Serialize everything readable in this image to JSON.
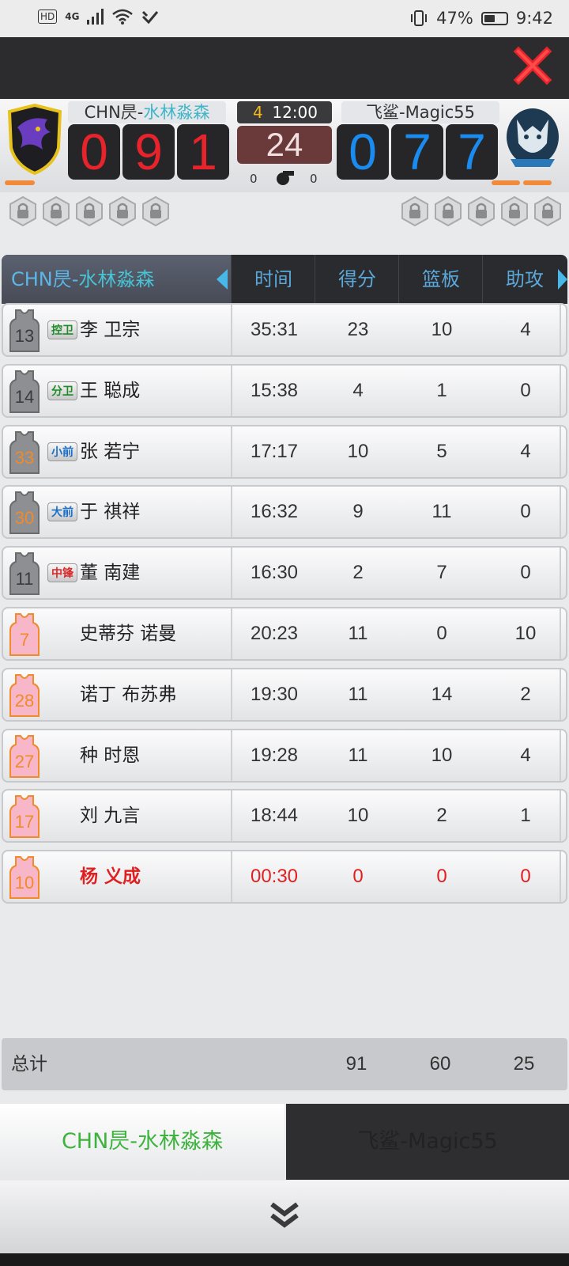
{
  "status_bar": {
    "hd": "HD",
    "network": "4G",
    "battery": "47%",
    "time": "9:42"
  },
  "scoreboard": {
    "home": {
      "name_prefix": "CHN昃-",
      "name_highlight": "水林淼森",
      "digits": [
        "0",
        "9",
        "1"
      ]
    },
    "away": {
      "name": "飞鲨-Magic55",
      "digits": [
        "0",
        "7",
        "7"
      ]
    },
    "quarter": "4",
    "game_clock": "12:00",
    "shot_clock": "24",
    "home_fouls": "0",
    "away_fouls": "0"
  },
  "table": {
    "team_prefix": "CHN昃-",
    "team_highlight": "水林淼森",
    "columns": [
      "时间",
      "得分",
      "篮板",
      "助攻"
    ],
    "rows": [
      {
        "number": "13",
        "position": "控卫",
        "name": "李 卫宗",
        "time": "35:31",
        "pts": "23",
        "reb": "10",
        "ast": "4"
      },
      {
        "number": "14",
        "position": "分卫",
        "name": "王 聪成",
        "time": "15:38",
        "pts": "4",
        "reb": "1",
        "ast": "0"
      },
      {
        "number": "33",
        "position": "小前",
        "name": "张 若宁",
        "time": "17:17",
        "pts": "10",
        "reb": "5",
        "ast": "4"
      },
      {
        "number": "30",
        "position": "大前",
        "name": "于 祺祥",
        "time": "16:32",
        "pts": "9",
        "reb": "11",
        "ast": "0"
      },
      {
        "number": "11",
        "position": "中锋",
        "name": "董 南建",
        "time": "16:30",
        "pts": "2",
        "reb": "7",
        "ast": "0"
      },
      {
        "number": "7",
        "position": "",
        "name": "史蒂芬 诺曼",
        "time": "20:23",
        "pts": "11",
        "reb": "0",
        "ast": "10"
      },
      {
        "number": "28",
        "position": "",
        "name": "诺丁 布苏弗",
        "time": "19:30",
        "pts": "11",
        "reb": "14",
        "ast": "2"
      },
      {
        "number": "27",
        "position": "",
        "name": "种 时恩",
        "time": "19:28",
        "pts": "11",
        "reb": "10",
        "ast": "4"
      },
      {
        "number": "17",
        "position": "",
        "name": "刘 九言",
        "time": "18:44",
        "pts": "10",
        "reb": "2",
        "ast": "1"
      },
      {
        "number": "10",
        "position": "",
        "name": "杨 义成",
        "time": "00:30",
        "pts": "0",
        "reb": "0",
        "ast": "0"
      }
    ],
    "totals": {
      "label": "总计",
      "pts": "91",
      "reb": "60",
      "ast": "25"
    }
  },
  "tabs": {
    "home_prefix": "CHN昃-",
    "home_highlight": "水林淼森",
    "away": "飞鲨-Magic55"
  },
  "colors": {
    "home_digit": "#e8232b",
    "away_digit": "#1a8cf0",
    "active_tab_text": "#3db33d",
    "bench_warning": "#e02020"
  }
}
